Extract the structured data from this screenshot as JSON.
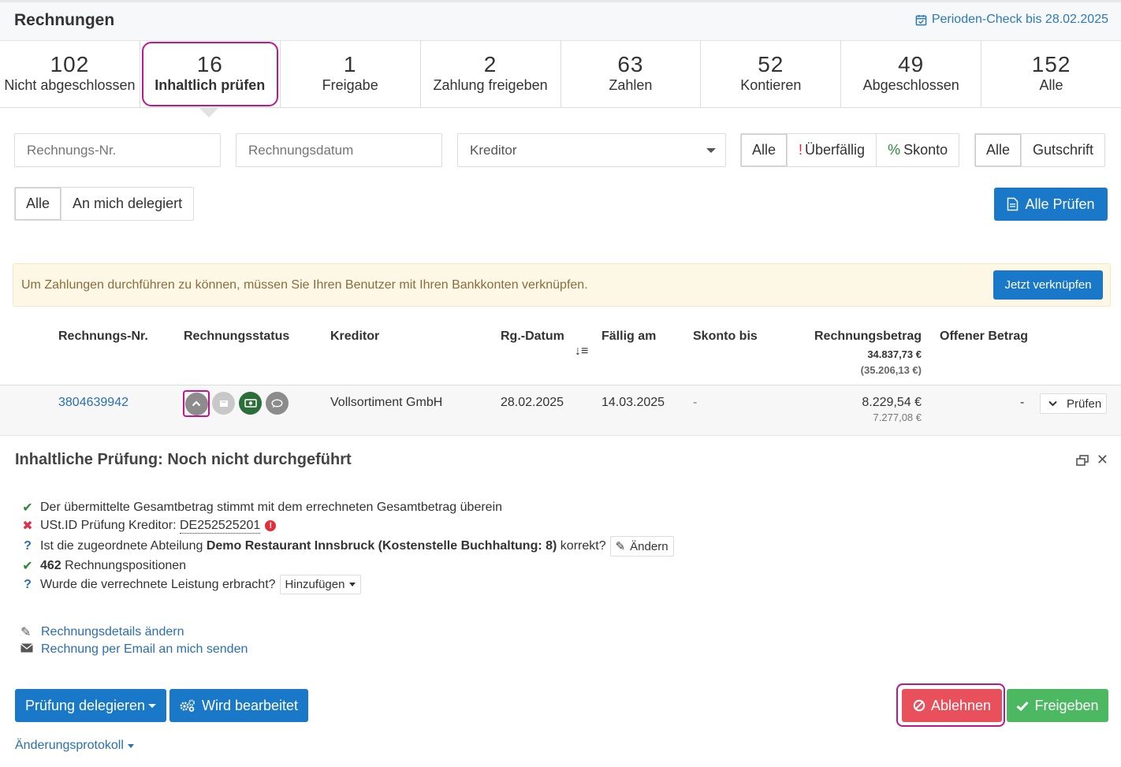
{
  "header": {
    "title": "Rechnungen",
    "period_check": "Perioden-Check bis 28.02.2025"
  },
  "tabs": [
    {
      "count": "102",
      "label": "Nicht abgeschlossen"
    },
    {
      "count": "16",
      "label": "Inhaltlich prüfen"
    },
    {
      "count": "1",
      "label": "Freigabe"
    },
    {
      "count": "2",
      "label": "Zahlung freigeben"
    },
    {
      "count": "63",
      "label": "Zahlen"
    },
    {
      "count": "52",
      "label": "Kontieren"
    },
    {
      "count": "49",
      "label": "Abgeschlossen"
    },
    {
      "count": "152",
      "label": "Alle"
    }
  ],
  "filters": {
    "invoice_no_placeholder": "Rechnungs-Nr.",
    "invoice_date_placeholder": "Rechnungsdatum",
    "creditor": "Kreditor",
    "status_all": "Alle",
    "status_overdue_mark": "!",
    "status_overdue": "Überfällig",
    "status_discount_mark": "%",
    "status_discount": "Skonto",
    "type_all": "Alle",
    "type_credit": "Gutschrift",
    "deleg_all": "Alle",
    "deleg_me": "An mich delegiert",
    "check_all": "Alle Prüfen"
  },
  "notice": {
    "text": "Um Zahlungen durchführen zu können, müssen Sie Ihren Benutzer mit Ihren Bankkonten verknüpfen.",
    "button": "Jetzt verknüpfen"
  },
  "table": {
    "headers": {
      "invoice_no": "Rechnungs-Nr.",
      "status": "Rechnungsstatus",
      "creditor": "Kreditor",
      "date": "Rg.-Datum",
      "due": "Fällig am",
      "discount": "Skonto bis",
      "amount": "Rechnungsbetrag",
      "amount_total": "34.837,73 €",
      "amount_total_sub": "(35.206,13 €)",
      "open": "Offener Betrag"
    },
    "row": {
      "invoice_no": "3804639942",
      "creditor": "Vollsortiment GmbH",
      "date": "28.02.2025",
      "due": "14.03.2025",
      "discount": "-",
      "amount": "8.229,54 €",
      "amount_sub": "7.277,08 €",
      "open": "-",
      "action": "Prüfen"
    }
  },
  "detail": {
    "title": "Inhaltliche Prüfung: Noch nicht durchgeführt",
    "check1": "Der übermittelte Gesamtbetrag stimmt mit dem errechneten Gesamtbetrag überein",
    "check2_label": "USt.ID Prüfung Kreditor:",
    "check2_value": "DE252525201",
    "check3_pre": "Ist die zugeordnete Abteilung",
    "check3_bold": "Demo Restaurant Innsbruck (Kostenstelle Buchhaltung: 8)",
    "check3_post": "korrekt?",
    "check3_btn": "Ändern",
    "check4_count": "462",
    "check4_label": "Rechnungspositionen",
    "check5": "Wurde die verrechnete Leistung erbracht?",
    "check5_btn": "Hinzufügen",
    "link_edit": "Rechnungsdetails ändern",
    "link_email": "Rechnung per Email an mich senden",
    "btn_delegate": "Prüfung delegieren",
    "btn_working": "Wird bearbeitet",
    "btn_reject": "Ablehnen",
    "btn_approve": "Freigeben",
    "changelog": "Änderungsprotokoll"
  },
  "colors": {
    "primary": "#1978c8",
    "danger": "#e8505b",
    "success": "#4cb862",
    "highlight": "#c0168c"
  }
}
